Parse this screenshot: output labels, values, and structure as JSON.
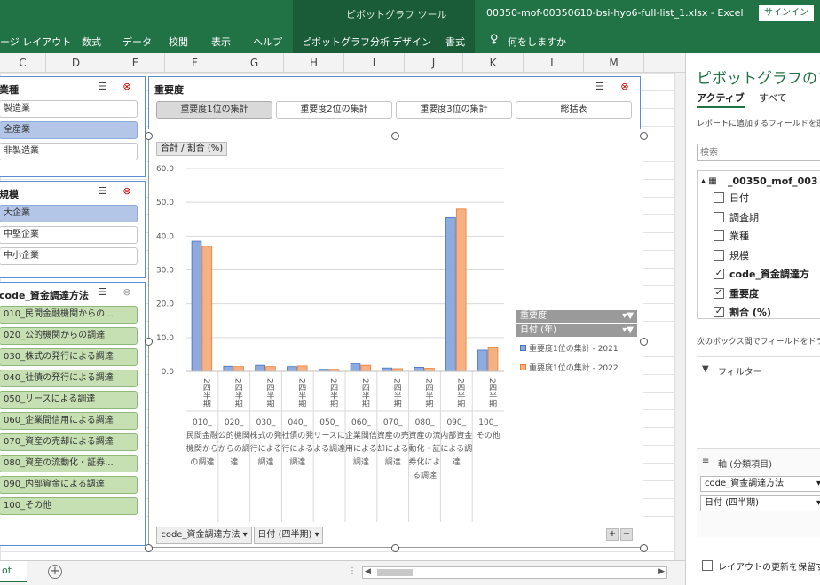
{
  "titlebar": {
    "context_tool": "ピボットグラフ ツール",
    "filename": "00350-mof-00350610-bsi-hyo6-full-list_1.xlsx - Excel",
    "signin": "サインイン"
  },
  "ribbon": {
    "tabs": [
      "ージ レイアウト",
      "数式",
      "データ",
      "校閲",
      "表示",
      "ヘルプ",
      "ピボットグラフ分析",
      "デザイン",
      "書式"
    ],
    "tellme": "何をしますか"
  },
  "columns": [
    "C",
    "D",
    "E",
    "F",
    "G",
    "H",
    "I",
    "J",
    "K",
    "L",
    "M"
  ],
  "slicer_industry": {
    "title": "業種",
    "items": [
      "製造業",
      "全産業",
      "非製造業"
    ]
  },
  "slicer_scale": {
    "title": "規模",
    "items": [
      "大企業",
      "中堅企業",
      "中小企業"
    ]
  },
  "slicer_method": {
    "title": "code_資金調達方法",
    "items": [
      "010_民間金融機関からの...",
      "020_公的機関からの調達",
      "030_株式の発行による調達",
      "040_社債の発行による調達",
      "050_リースによる調達",
      "060_企業間信用による調達",
      "070_資産の売却による調達",
      "080_資産の流動化・証券...",
      "090_内部資金による調達",
      "100_その他"
    ]
  },
  "slicer_importance": {
    "title": "重要度",
    "items": [
      "重要度1位の集計",
      "重要度2位の集計",
      "重要度3位の集計",
      "総括表"
    ]
  },
  "chart": {
    "value_field": "合計 / 割合 (%)",
    "axis_buttons": [
      "code_資金調達方法",
      "日付 (四半期)"
    ],
    "legend_field1": "重要度",
    "legend_field2": "日付 (年)",
    "zoom": [
      "+",
      "−"
    ],
    "period_label": "2四半期"
  },
  "chart_data": {
    "type": "bar",
    "categories": [
      "010_民間金融機関からの調達",
      "020_公的機関からの調達",
      "030_株式の発行による調達",
      "040_社債の発行による調達",
      "050_リースによる調達",
      "060_企業間信用による調達",
      "070_資産の売却による調達",
      "080_資産の流動化・証券化による調達",
      "090_内部資金による調達",
      "100_その他"
    ],
    "series": [
      {
        "name": "重要度1位の集計 - 2021",
        "values": [
          38.5,
          1.5,
          1.8,
          1.4,
          0.6,
          2.2,
          1.0,
          1.2,
          45.5,
          6.3
        ],
        "color": "#8faadc"
      },
      {
        "name": "重要度1位の集計 - 2022",
        "values": [
          37.0,
          1.4,
          1.4,
          1.6,
          0.6,
          1.8,
          0.8,
          0.9,
          48.0,
          7.0
        ],
        "color": "#f4b183"
      }
    ],
    "ylim": [
      0,
      60
    ],
    "yticks": [
      "0.0",
      "10.0",
      "20.0",
      "30.0",
      "40.0",
      "50.0",
      "60.0"
    ]
  },
  "pane": {
    "title": "ピボットグラフのフィ",
    "tabs": [
      "アクティブ",
      "すべて"
    ],
    "hint": "レポートに追加するフィールドを選",
    "search_placeholder": "検索",
    "table": "_00350_mof_003",
    "fields": [
      {
        "label": "日付",
        "checked": false
      },
      {
        "label": "調査期",
        "checked": false
      },
      {
        "label": "業種",
        "checked": false
      },
      {
        "label": "規模",
        "checked": false
      },
      {
        "label": "code_資金調達方",
        "checked": true
      },
      {
        "label": "重要度",
        "checked": true
      },
      {
        "label": "割合 (%)",
        "checked": true
      }
    ],
    "drag_hint": "次のボックス間でフィールドをドラ",
    "filter_label": "フィルター",
    "axis_label": "軸 (分類項目)",
    "axis_items": [
      "code_資金調達方法",
      "日付 (四半期)"
    ],
    "defer_label": "レイアウトの更新を保留す"
  },
  "statusbar": {
    "sheet": "ot",
    "add": "+"
  }
}
